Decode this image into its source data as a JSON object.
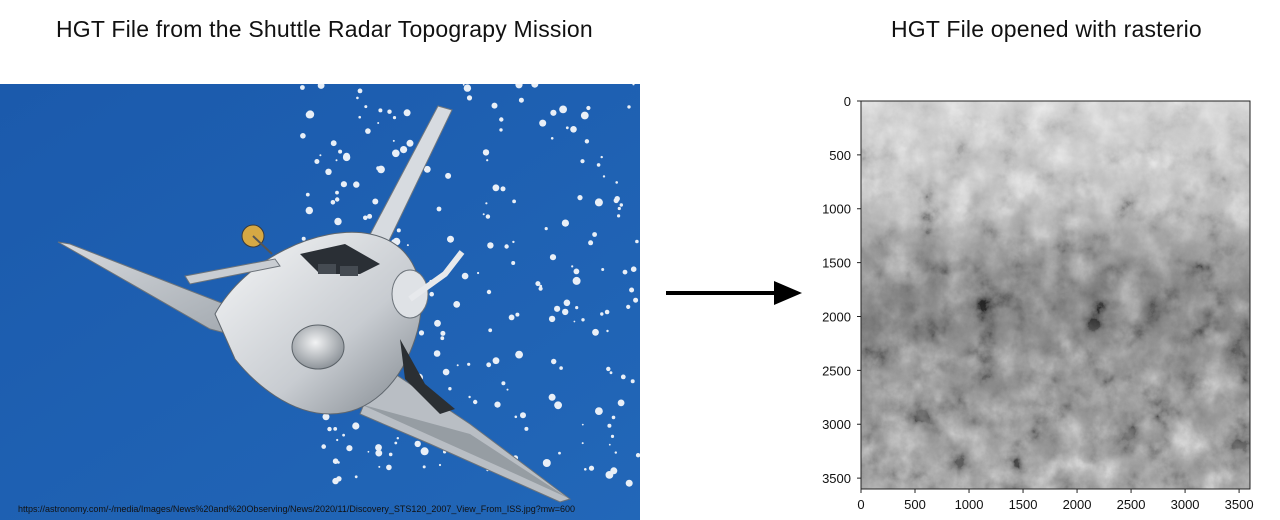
{
  "left_panel": {
    "title": "HGT File from the Shuttle Radar Topograpy Mission",
    "image_subject": "Space Shuttle Discovery in orbit over clouds and ocean",
    "caption": "https://astronomy.com/-/media/Images/News%20and%20Observing/News/2020/11/Discovery_STS120_2007_View_From_ISS.jpg?mw=600",
    "colors": {
      "sky": "#1f63b4",
      "hull": "#e9ecef",
      "clouds": "#ffffff"
    }
  },
  "arrow": {
    "direction": "right",
    "color": "#000000"
  },
  "right_panel": {
    "title": "HGT File opened with rasterio",
    "colormap": "grayscale",
    "chart_data": {
      "type": "heatmap",
      "title": "",
      "xlabel": "",
      "ylabel": "",
      "xlim": [
        0,
        3601
      ],
      "ylim": [
        3601,
        0
      ],
      "x_ticks": [
        0,
        500,
        1000,
        1500,
        2000,
        2500,
        3000,
        3500
      ],
      "y_ticks": [
        0,
        500,
        1000,
        1500,
        2000,
        2500,
        3000,
        3500
      ],
      "grid": false
    }
  }
}
